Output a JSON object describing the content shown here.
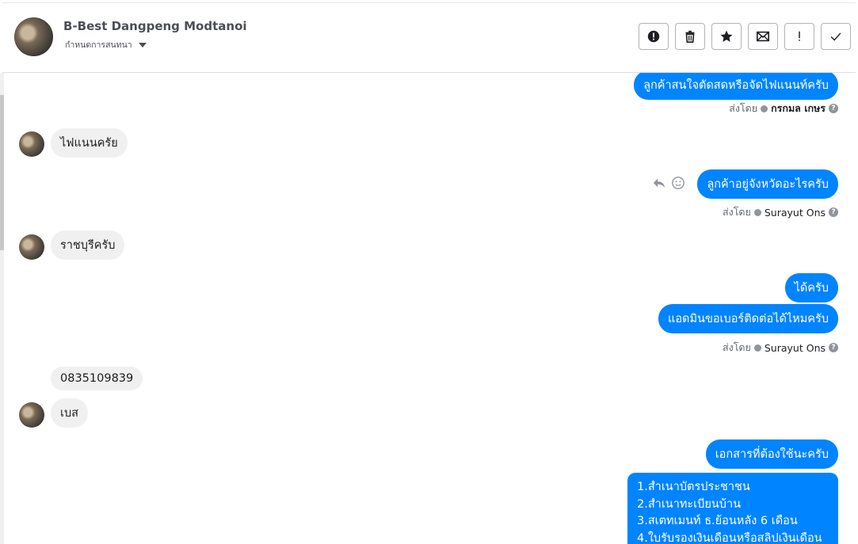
{
  "header": {
    "contact_name": "B-Best Dangpeng Modtanoi",
    "conversation_label": "กำหนดการสนทนา",
    "toolbar_icons": [
      "alert-circle-icon",
      "trash-icon",
      "star-icon",
      "envelope-icon",
      "exclamation-icon",
      "check-icon"
    ]
  },
  "messages": {
    "m1_out": "ลูกค้าสนใจตัดสดหรือจัดไฟแนนท์ครับ",
    "m1_sentby_prefix": "ส่งโดย",
    "m1_sentby_name": "กรกมล เกษร",
    "m2_in": "ไฟแนนครัย",
    "m3_out": "ลูกค้าอยู่จังหวัดอะไรครับ",
    "m3_sentby_prefix": "ส่งโดย",
    "m3_sentby_name": "Surayut Ons",
    "m4_in": "ราชบุรีครับ",
    "m5_out": "ได้ครับ",
    "m6_out": "แอดมินขอเบอร์ติดต่อได้ไหมครับ",
    "m6_sentby_prefix": "ส่งโดย",
    "m6_sentby_name": "Surayut Ons",
    "m7_in": "0835109839",
    "m8_in": "เบส",
    "m9_out": "เอกสารที่ต้องใช้นะครับ",
    "m10_lines": [
      "1.สำเนาบัตรประชาชน",
      "2.สำเนาทะเบียนบ้าน",
      "3.สเตทเมนท์ ธ.ย้อนหลัง 6 เดือน",
      "4.ใบรับรองเงินเดือนหรือสลิปเงินเดือน"
    ]
  }
}
